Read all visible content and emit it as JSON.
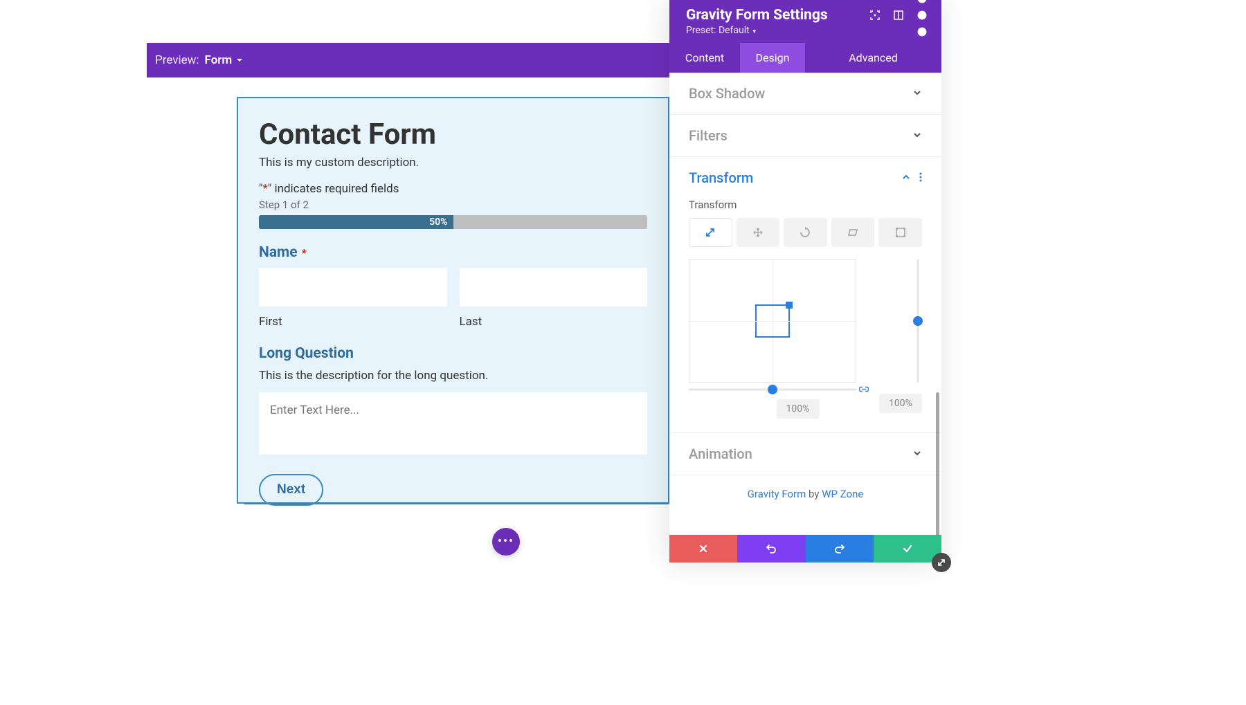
{
  "preview": {
    "label": "Preview:",
    "value": "Form"
  },
  "form": {
    "title": "Contact Form",
    "description": "This is my custom description.",
    "required_prefix": "\"",
    "required_star": "*",
    "required_suffix": "\" indicates required fields",
    "step": "Step 1 of 2",
    "progress_pct": "50%",
    "name_label": "Name",
    "first_sub": "First",
    "last_sub": "Last",
    "long_label": "Long Question",
    "long_desc": "This is the description for the long question.",
    "textarea_placeholder": "Enter Text Here...",
    "next": "Next"
  },
  "panel": {
    "title": "Gravity Form Settings",
    "preset": "Preset: Default",
    "tabs": {
      "content": "Content",
      "design": "Design",
      "advanced": "Advanced"
    },
    "sections": {
      "box_shadow": "Box Shadow",
      "filters": "Filters",
      "transform": "Transform",
      "animation": "Animation"
    },
    "transform": {
      "label": "Transform",
      "h_value": "100%",
      "v_value": "100%"
    },
    "credit": {
      "link1": "Gravity Form",
      "by": " by ",
      "link2": "WP Zone"
    }
  }
}
